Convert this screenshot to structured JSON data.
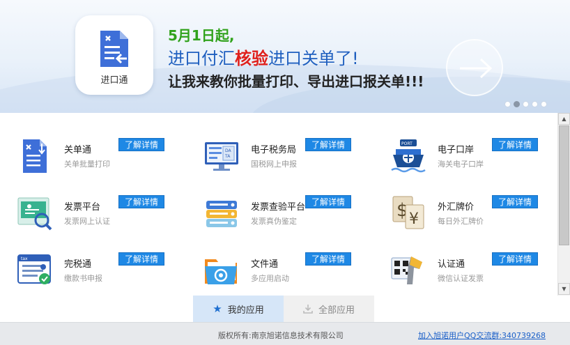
{
  "banner": {
    "app_name": "进口通",
    "line1": "5月1日起,",
    "line2_pre": "进口付汇",
    "line2_highlight": "核验",
    "line2_post": "进口关单了!",
    "line3": "让我来教你批量打印、导出进口报关单!!!",
    "dots_active_index": 1
  },
  "detail_label": "了解详情",
  "apps": [
    {
      "name": "关单通",
      "desc": "关单批量打印",
      "icon": "customs-doc-icon"
    },
    {
      "name": "电子税务局",
      "desc": "国税网上申报",
      "icon": "tax-monitor-icon"
    },
    {
      "name": "电子口岸",
      "desc": "海关电子口岸",
      "icon": "port-ship-icon"
    },
    {
      "name": "发票平台",
      "desc": "发票网上认证",
      "icon": "invoice-search-icon"
    },
    {
      "name": "发票查验平台",
      "desc": "发票真伪鉴定",
      "icon": "invoice-stack-icon"
    },
    {
      "name": "外汇牌价",
      "desc": "每日外汇牌价",
      "icon": "currency-icon"
    },
    {
      "name": "完税通",
      "desc": "缴款书申报",
      "icon": "tax-calendar-icon"
    },
    {
      "name": "文件通",
      "desc": "多应用启动",
      "icon": "folder-icon"
    },
    {
      "name": "认证通",
      "desc": "微信认证发票",
      "icon": "scanner-icon"
    }
  ],
  "tabs": {
    "mine": "我的应用",
    "all": "全部应用"
  },
  "footer": {
    "copyright": "版权所有:南京旭诺信息技术有限公司",
    "qq_link": "加入旭诺用户QQ交流群:340739268"
  }
}
